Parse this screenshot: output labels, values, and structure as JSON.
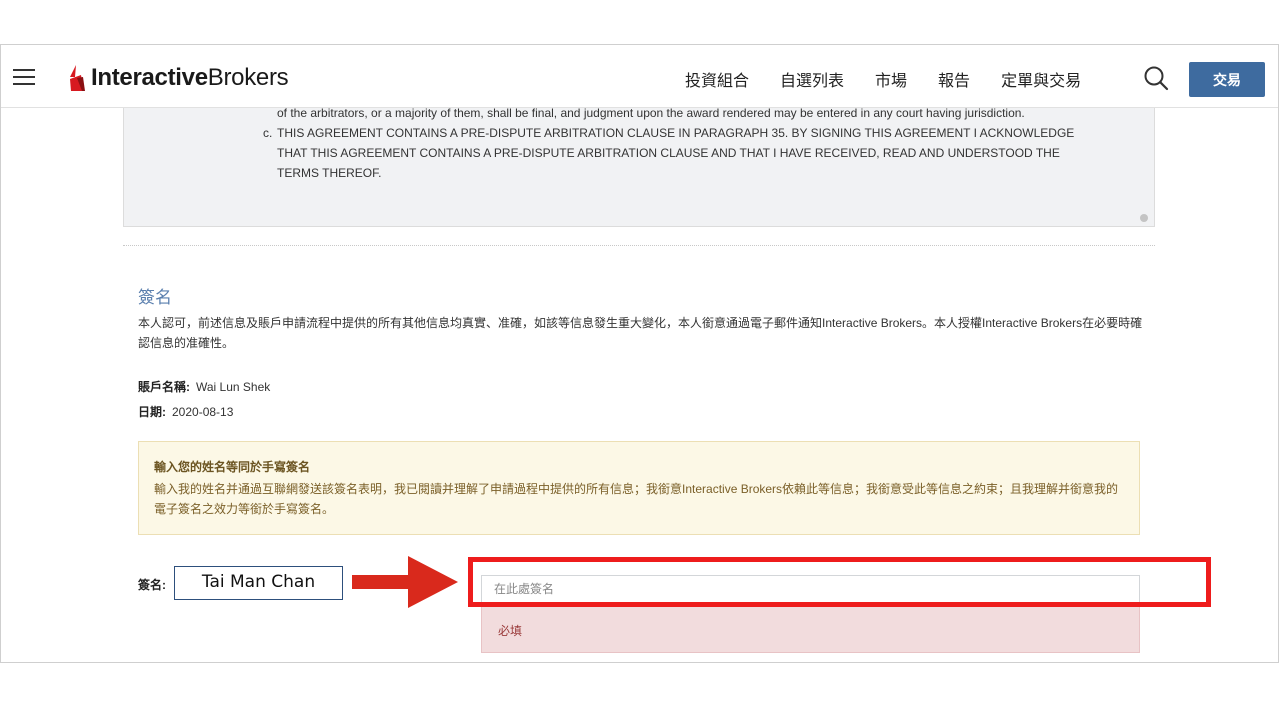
{
  "header": {
    "logo_bold": "Interactive",
    "logo_light": "Brokers",
    "nav": [
      "投資組合",
      "自選列表",
      "市場",
      "報告",
      "定單與交易"
    ],
    "trade_label": "交易"
  },
  "agreement": {
    "line1": "of the arbitrators, or a majority of them, shall be final, and judgment upon the award rendered may be entered in any court having jurisdiction.",
    "line2_marker": "c.",
    "line2": "THIS AGREEMENT CONTAINS A PRE-DISPUTE ARBITRATION CLAUSE IN PARAGRAPH 35. BY SIGNING THIS AGREEMENT I ACKNOWLEDGE",
    "line3": "THAT THIS AGREEMENT CONTAINS A PRE-DISPUTE ARBITRATION CLAUSE AND THAT I HAVE RECEIVED, READ AND UNDERSTOOD THE",
    "line4": "TERMS THEREOF."
  },
  "signature": {
    "title": "簽名",
    "description": "本人認可，前述信息及賬戶申請流程中提供的所有其他信息均真實、准確，如該等信息發生重大變化，本人銜意通過電子郵件通知Interactive Brokers。本人授權Interactive Brokers在必要時確認信息的准確性。",
    "account_label": "賬戶名稱:",
    "account_value": "Wai Lun Shek",
    "date_label": "日期:",
    "date_value": "2020-08-13",
    "notice_title": "輸入您的姓名等同於手寫簽名",
    "notice_body": "輸入我的姓名并通過互聯網發送該簽名表明，我已閱讀并理解了申請過程中提供的所有信息；我銜意Interactive Brokers依賴此等信息；我銜意受此等信息之約束；且我理解并銜意我的電子簽名之效力等銜於手寫簽名。",
    "field_label": "簽名:",
    "placeholder": "在此處簽名",
    "required_text": "必填"
  },
  "annotation": {
    "example_name": "Tai Man Chan",
    "arrow_color": "#d9291c",
    "highlight_color": "#ee1c1c"
  }
}
